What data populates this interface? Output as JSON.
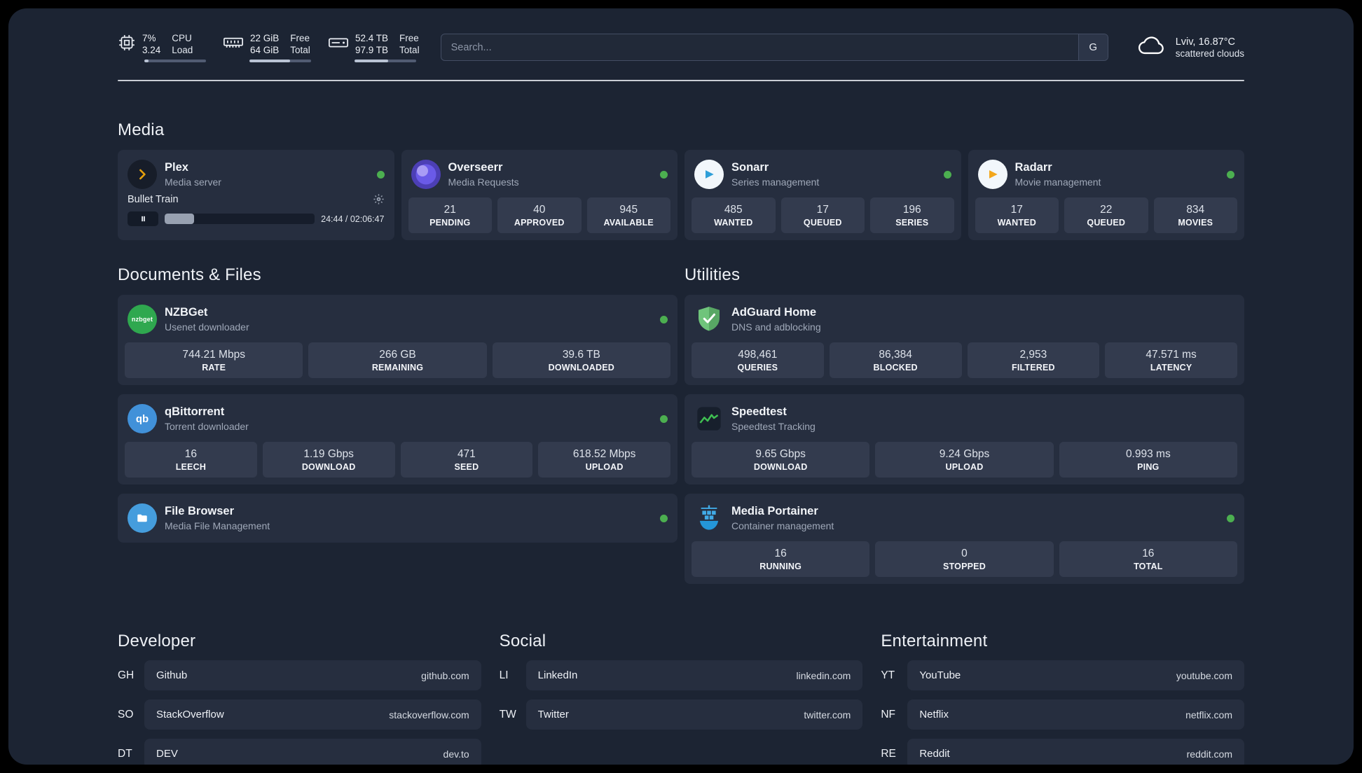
{
  "topbar": {
    "cpu": {
      "value_top": "7%",
      "label_top": "CPU",
      "value_bottom": "3.24",
      "label_bottom": "Load",
      "bar_percent": 7
    },
    "ram": {
      "value_top": "22 GiB",
      "label_top": "Free",
      "value_bottom": "64 GiB",
      "label_bottom": "Total",
      "bar_percent": 66
    },
    "disk": {
      "value_top": "52.4 TB",
      "label_top": "Free",
      "value_bottom": "97.9 TB",
      "label_bottom": "Total",
      "bar_percent": 54
    },
    "search": {
      "placeholder": "Search...",
      "engine_button": "G"
    },
    "weather": {
      "location": "Lviv, 16.87°C",
      "condition": "scattered clouds"
    }
  },
  "colors": {
    "status_online": "#4caf50",
    "plex_accent": "#e5a00d"
  },
  "sections": {
    "media": {
      "title": "Media",
      "plex": {
        "name": "Plex",
        "subtitle": "Media server",
        "now_playing": {
          "title": "Bullet Train",
          "time": "24:44 / 02:06:47",
          "progress_percent": 19.5
        }
      },
      "overseerr": {
        "name": "Overseerr",
        "subtitle": "Media Requests",
        "stats": [
          {
            "value": "21",
            "label": "PENDING"
          },
          {
            "value": "40",
            "label": "APPROVED"
          },
          {
            "value": "945",
            "label": "AVAILABLE"
          }
        ]
      },
      "sonarr": {
        "name": "Sonarr",
        "subtitle": "Series management",
        "stats": [
          {
            "value": "485",
            "label": "WANTED"
          },
          {
            "value": "17",
            "label": "QUEUED"
          },
          {
            "value": "196",
            "label": "SERIES"
          }
        ]
      },
      "radarr": {
        "name": "Radarr",
        "subtitle": "Movie management",
        "stats": [
          {
            "value": "17",
            "label": "WANTED"
          },
          {
            "value": "22",
            "label": "QUEUED"
          },
          {
            "value": "834",
            "label": "MOVIES"
          }
        ]
      }
    },
    "documents": {
      "title": "Documents & Files",
      "nzbget": {
        "name": "NZBGet",
        "subtitle": "Usenet downloader",
        "icon_text": "nzbget",
        "stats": [
          {
            "value": "744.21 Mbps",
            "label": "RATE"
          },
          {
            "value": "266 GB",
            "label": "REMAINING"
          },
          {
            "value": "39.6 TB",
            "label": "DOWNLOADED"
          }
        ]
      },
      "qbittorrent": {
        "name": "qBittorrent",
        "subtitle": "Torrent downloader",
        "icon_text": "qb",
        "stats": [
          {
            "value": "16",
            "label": "LEECH"
          },
          {
            "value": "1.19 Gbps",
            "label": "DOWNLOAD"
          },
          {
            "value": "471",
            "label": "SEED"
          },
          {
            "value": "618.52 Mbps",
            "label": "UPLOAD"
          }
        ]
      },
      "filebrowser": {
        "name": "File Browser",
        "subtitle": "Media File Management"
      }
    },
    "utilities": {
      "title": "Utilities",
      "adguard": {
        "name": "AdGuard Home",
        "subtitle": "DNS and adblocking",
        "stats": [
          {
            "value": "498,461",
            "label": "QUERIES"
          },
          {
            "value": "86,384",
            "label": "BLOCKED"
          },
          {
            "value": "2,953",
            "label": "FILTERED"
          },
          {
            "value": "47.571 ms",
            "label": "LATENCY"
          }
        ]
      },
      "speedtest": {
        "name": "Speedtest",
        "subtitle": "Speedtest Tracking",
        "stats": [
          {
            "value": "9.65 Gbps",
            "label": "DOWNLOAD"
          },
          {
            "value": "9.24 Gbps",
            "label": "UPLOAD"
          },
          {
            "value": "0.993 ms",
            "label": "PING"
          }
        ]
      },
      "portainer": {
        "name": "Media Portainer",
        "subtitle": "Container management",
        "stats": [
          {
            "value": "16",
            "label": "RUNNING"
          },
          {
            "value": "0",
            "label": "STOPPED"
          },
          {
            "value": "16",
            "label": "TOTAL"
          }
        ]
      }
    },
    "links": {
      "developer": {
        "title": "Developer",
        "items": [
          {
            "abbr": "GH",
            "name": "Github",
            "url": "github.com"
          },
          {
            "abbr": "SO",
            "name": "StackOverflow",
            "url": "stackoverflow.com"
          },
          {
            "abbr": "DT",
            "name": "DEV",
            "url": "dev.to"
          }
        ]
      },
      "social": {
        "title": "Social",
        "items": [
          {
            "abbr": "LI",
            "name": "LinkedIn",
            "url": "linkedin.com"
          },
          {
            "abbr": "TW",
            "name": "Twitter",
            "url": "twitter.com"
          }
        ]
      },
      "entertainment": {
        "title": "Entertainment",
        "items": [
          {
            "abbr": "YT",
            "name": "YouTube",
            "url": "youtube.com"
          },
          {
            "abbr": "NF",
            "name": "Netflix",
            "url": "netflix.com"
          },
          {
            "abbr": "RE",
            "name": "Reddit",
            "url": "reddit.com"
          }
        ]
      }
    }
  }
}
